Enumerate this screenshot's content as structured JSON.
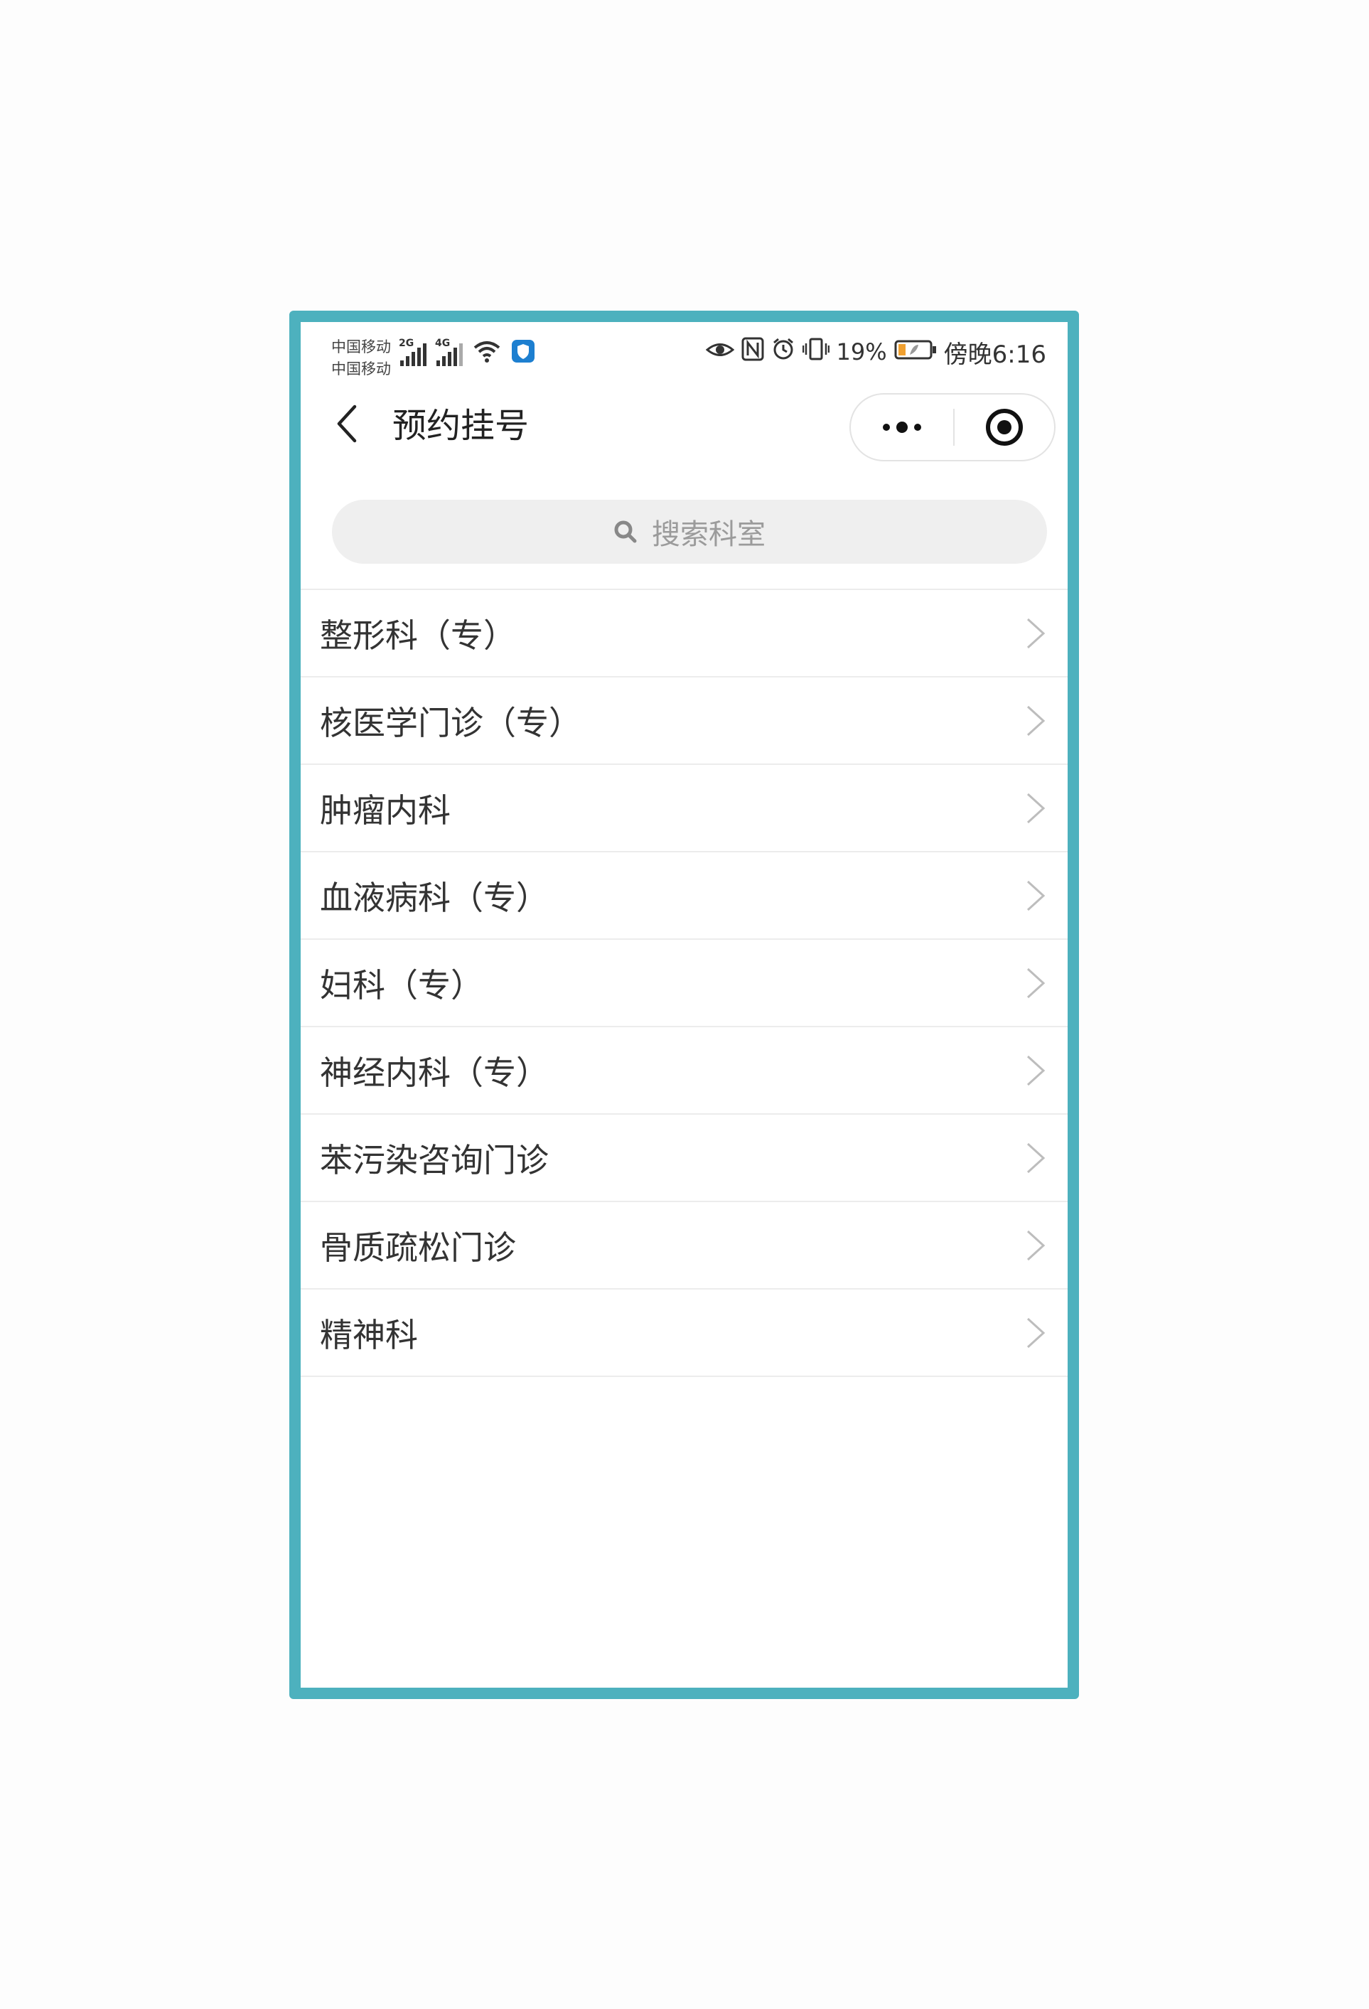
{
  "status_bar": {
    "carrier_1": "中国移动",
    "carrier_2": "中国移动",
    "net_1": "2G",
    "net_2": "4G",
    "battery": "19%",
    "time": "傍晚6:16"
  },
  "header": {
    "title": "预约挂号"
  },
  "search": {
    "placeholder": "搜索科室"
  },
  "departments": [
    "整形科（专）",
    "核医学门诊（专）",
    "肿瘤内科",
    "血液病科（专）",
    "妇科（专）",
    "神经内科（专）",
    "苯污染咨询门诊",
    "骨质疏松门诊",
    "精神科"
  ],
  "colors": {
    "frame_border": "#4db1be",
    "battery_fill": "#f0a030",
    "shield_icon": "#1d7fd0"
  }
}
